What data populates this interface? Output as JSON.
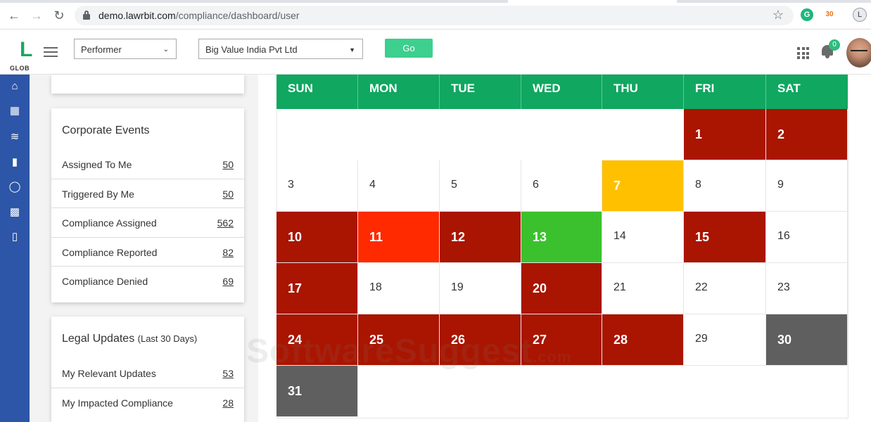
{
  "browser": {
    "url_host": "demo.lawrbit.com",
    "url_path": "/compliance/dashboard/user",
    "profile_initial": "L",
    "extension_badge": "30"
  },
  "header": {
    "logo_letter": "L",
    "logo_text": "GLOB",
    "role_select": "Performer",
    "company_select": "Big Value India Pvt Ltd",
    "go_label": "Go",
    "notification_count": "0"
  },
  "sidebar": {
    "items": [
      "home-icon",
      "calendar-icon",
      "activity-icon",
      "document-icon",
      "circle-icon",
      "ticket-icon",
      "chat-icon"
    ]
  },
  "corporate_events": {
    "title": "Corporate Events",
    "rows": [
      {
        "label": "Assigned To Me",
        "value": "50"
      },
      {
        "label": "Triggered By Me",
        "value": "50"
      },
      {
        "label": "Compliance Assigned",
        "value": "562"
      },
      {
        "label": "Compliance Reported",
        "value": "82"
      },
      {
        "label": "Compliance Denied",
        "value": "69"
      }
    ]
  },
  "legal_updates": {
    "title": "Legal Updates",
    "subtitle": "(Last 30 Days)",
    "rows": [
      {
        "label": "My Relevant Updates",
        "value": "53"
      },
      {
        "label": "My Impacted Compliance",
        "value": "28"
      }
    ]
  },
  "calendar": {
    "days_of_week": [
      "SUN",
      "MON",
      "TUE",
      "WED",
      "THU",
      "FRI",
      "SAT"
    ],
    "weeks": [
      [
        null,
        null,
        null,
        null,
        null,
        {
          "d": "1",
          "s": "red"
        },
        {
          "d": "2",
          "s": "red"
        }
      ],
      [
        {
          "d": "3"
        },
        {
          "d": "4"
        },
        {
          "d": "5"
        },
        {
          "d": "6"
        },
        {
          "d": "7",
          "s": "amber"
        },
        {
          "d": "8"
        },
        {
          "d": "9"
        }
      ],
      [
        {
          "d": "10",
          "s": "red"
        },
        {
          "d": "11",
          "s": "orange"
        },
        {
          "d": "12",
          "s": "red"
        },
        {
          "d": "13",
          "s": "green"
        },
        {
          "d": "14"
        },
        {
          "d": "15",
          "s": "red"
        },
        {
          "d": "16"
        }
      ],
      [
        {
          "d": "17",
          "s": "red"
        },
        {
          "d": "18"
        },
        {
          "d": "19"
        },
        {
          "d": "20",
          "s": "red"
        },
        {
          "d": "21"
        },
        {
          "d": "22"
        },
        {
          "d": "23"
        }
      ],
      [
        {
          "d": "24",
          "s": "red"
        },
        {
          "d": "25",
          "s": "red"
        },
        {
          "d": "26",
          "s": "red"
        },
        {
          "d": "27",
          "s": "red"
        },
        {
          "d": "28",
          "s": "red"
        },
        {
          "d": "29"
        },
        {
          "d": "30",
          "s": "grey"
        }
      ],
      [
        {
          "d": "31",
          "s": "grey"
        },
        null,
        null,
        null,
        null,
        null,
        null
      ]
    ],
    "status_colors": {
      "red": "#a91500",
      "orange": "#ff2a00",
      "amber": "#ffc000",
      "green": "#3cc12e",
      "grey": "#5f5f5f"
    }
  },
  "watermark": {
    "text": "SoftwareSuggest",
    "tld": ".com"
  }
}
